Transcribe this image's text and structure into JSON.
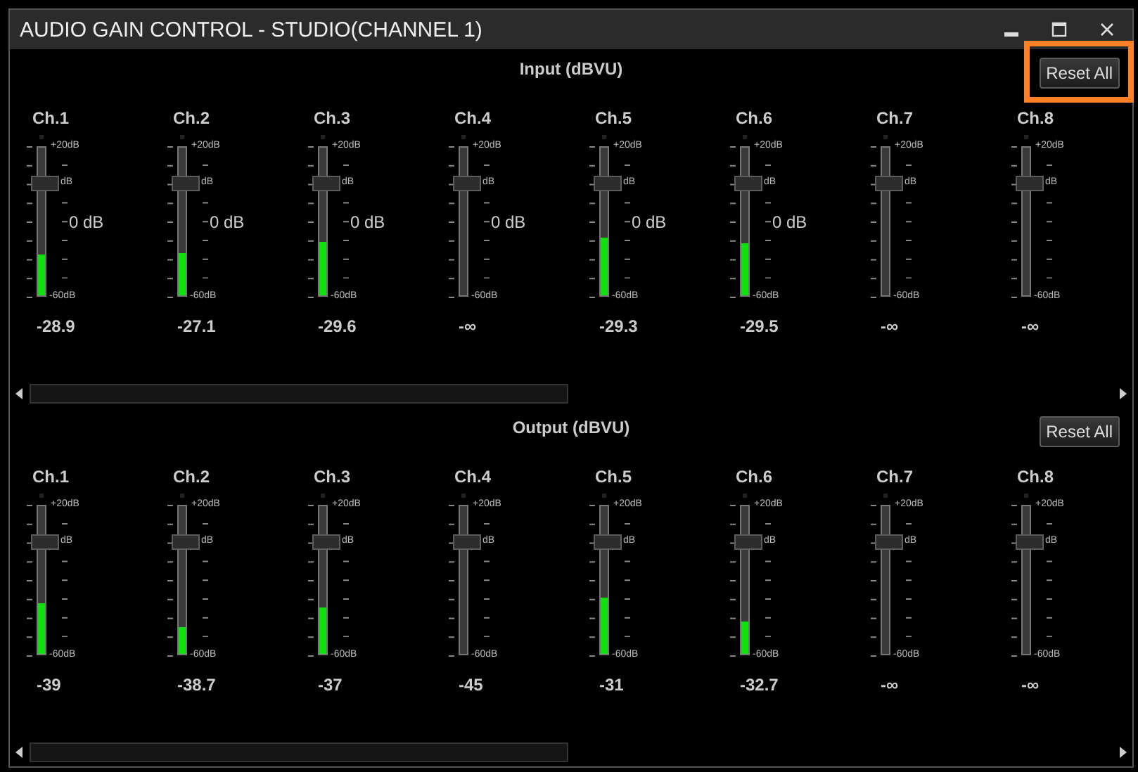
{
  "window": {
    "title": "AUDIO GAIN CONTROL - STUDIO(CHANNEL 1)"
  },
  "sections": [
    {
      "title": "Input (dBVU)",
      "reset_button": {
        "label": "Reset All",
        "highlighted": true
      },
      "channels": [
        {
          "label": "Ch.1",
          "scale_top": "+20dB",
          "scale_mid": "dB",
          "scale_bottom": "-60dB",
          "gain": "0 dB",
          "fader": {
            "level": 0.75
          },
          "meter": {
            "level": 0.28
          },
          "reading": "-28.9"
        },
        {
          "label": "Ch.2",
          "scale_top": "+20dB",
          "scale_mid": "dB",
          "scale_bottom": "-60dB",
          "gain": "0 dB",
          "fader": {
            "level": 0.75
          },
          "meter": {
            "level": 0.29
          },
          "reading": "-27.1"
        },
        {
          "label": "Ch.3",
          "scale_top": "+20dB",
          "scale_mid": "dB",
          "scale_bottom": "-60dB",
          "gain": "0 dB",
          "fader": {
            "level": 0.75
          },
          "meter": {
            "level": 0.36
          },
          "reading": "-29.6"
        },
        {
          "label": "Ch.4",
          "scale_top": "+20dB",
          "scale_mid": "dB",
          "scale_bottom": "-60dB",
          "gain": "0 dB",
          "fader": {
            "level": 0.75
          },
          "reading": "-∞"
        },
        {
          "label": "Ch.5",
          "scale_top": "+20dB",
          "scale_mid": "dB",
          "scale_bottom": "-60dB",
          "gain": "0 dB",
          "fader": {
            "level": 0.75
          },
          "meter": {
            "level": 0.39
          },
          "reading": "-29.3"
        },
        {
          "label": "Ch.6",
          "scale_top": "+20dB",
          "scale_mid": "dB",
          "scale_bottom": "-60dB",
          "gain": "0 dB",
          "fader": {
            "level": 0.75
          },
          "meter": {
            "level": 0.35
          },
          "reading": "-29.5"
        },
        {
          "label": "Ch.7",
          "scale_top": "+20dB",
          "scale_mid": "dB",
          "scale_bottom": "-60dB",
          "fader": {
            "level": 0.75
          },
          "reading": "-∞"
        },
        {
          "label": "Ch.8",
          "scale_top": "+20dB",
          "scale_mid": "dB",
          "scale_bottom": "-60dB",
          "fader": {
            "level": 0.75
          },
          "reading": "-∞"
        }
      ]
    },
    {
      "title": "Output (dBVU)",
      "reset_button": {
        "label": "Reset All",
        "highlighted": false
      },
      "channels": [
        {
          "label": "Ch.1",
          "scale_top": "+20dB",
          "scale_mid": "dB",
          "scale_bottom": "-60dB",
          "fader": {
            "level": 0.75
          },
          "meter": {
            "level": 0.34
          },
          "reading": "-39"
        },
        {
          "label": "Ch.2",
          "scale_top": "+20dB",
          "scale_mid": "dB",
          "scale_bottom": "-60dB",
          "fader": {
            "level": 0.75
          },
          "meter": {
            "level": 0.18
          },
          "reading": "-38.7"
        },
        {
          "label": "Ch.3",
          "scale_top": "+20dB",
          "scale_mid": "dB",
          "scale_bottom": "-60dB",
          "fader": {
            "level": 0.75
          },
          "meter": {
            "level": 0.31
          },
          "reading": "-37"
        },
        {
          "label": "Ch.4",
          "scale_top": "+20dB",
          "scale_mid": "dB",
          "scale_bottom": "-60dB",
          "fader": {
            "level": 0.75
          },
          "reading": "-45"
        },
        {
          "label": "Ch.5",
          "scale_top": "+20dB",
          "scale_mid": "dB",
          "scale_bottom": "-60dB",
          "fader": {
            "level": 0.75
          },
          "meter": {
            "level": 0.38
          },
          "reading": "-31"
        },
        {
          "label": "Ch.6",
          "scale_top": "+20dB",
          "scale_mid": "dB",
          "scale_bottom": "-60dB",
          "fader": {
            "level": 0.75
          },
          "meter": {
            "level": 0.22
          },
          "reading": "-32.7"
        },
        {
          "label": "Ch.7",
          "scale_top": "+20dB",
          "scale_mid": "dB",
          "scale_bottom": "-60dB",
          "fader": {
            "level": 0.75
          },
          "reading": "-∞"
        },
        {
          "label": "Ch.8",
          "scale_top": "+20dB",
          "scale_mid": "dB",
          "scale_bottom": "-60dB",
          "fader": {
            "level": 0.75
          },
          "reading": "-∞"
        }
      ]
    }
  ]
}
